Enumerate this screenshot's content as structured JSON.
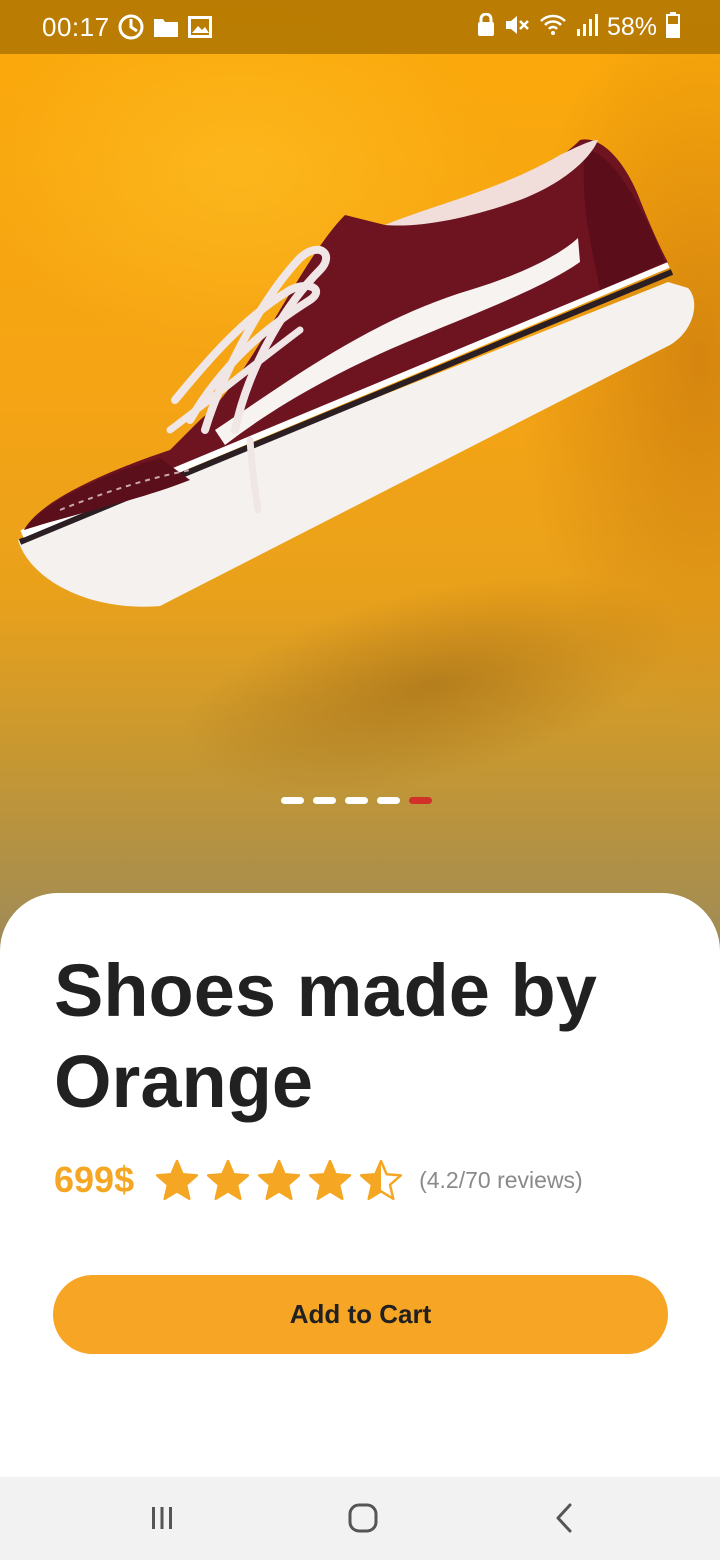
{
  "status_bar": {
    "time": "00:17",
    "battery": "58%",
    "left_icons": [
      "data-usage-icon",
      "folder-icon",
      "gallery-icon"
    ],
    "right_icons": [
      "vpn-lock-icon",
      "mute-icon",
      "wifi-icon",
      "signal-icon",
      "battery-icon"
    ]
  },
  "hero": {
    "image_alt": "shoe-image",
    "carousel": {
      "total": 5,
      "active_index": 4
    }
  },
  "product": {
    "title_line1": "Shoes made by",
    "title_line2": "Orange",
    "price": "699$",
    "rating": 4.2,
    "max_rating": 5,
    "reviews_text": "(4.2/70 reviews)"
  },
  "actions": {
    "add_to_cart_label": "Add to Cart"
  },
  "nav_bar": {
    "buttons": [
      "recent-apps-icon",
      "home-icon",
      "back-icon"
    ]
  },
  "colors": {
    "accent": "#f7a524",
    "price": "#f5a623",
    "title": "#212121",
    "active_dot": "#d2312b",
    "shoe_body": "#6e1420"
  }
}
